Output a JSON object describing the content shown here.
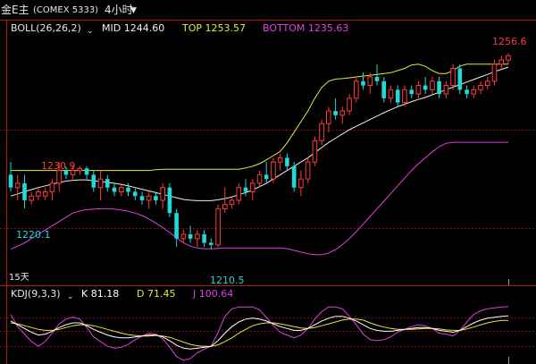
{
  "header": {
    "symbol": "金E主",
    "exchange": "(COMEX 5333)",
    "period": "4小时",
    "period_caret": "▼"
  },
  "boll": {
    "label": "BOLL(26,26,2)",
    "mid": "MID 1244.60",
    "top": "TOP 1253.57",
    "bottom": "BOTTOM 1235.63"
  },
  "kdj": {
    "label": "KDJ(9,3,3)",
    "k": "K 81.18",
    "d": "D 71.45",
    "j": "J 100.64"
  },
  "annotations": {
    "high_last": "1256.6",
    "high_left": "1230.9",
    "low_left": "1220.1",
    "low_mid": "1210.5",
    "days": "15天"
  },
  "colors": {
    "up": "#ff3b3b",
    "down": "#21d9d9",
    "mid": "#f0f0f0",
    "top": "#e6e640",
    "bottom": "#e040e0",
    "k": "#ffffff",
    "d": "#e6e640",
    "j": "#e040e0",
    "grid": "#7a1212",
    "axis": "#b01818"
  },
  "chart_data": {
    "type": "candlestick",
    "y_range": [
      1206,
      1259
    ],
    "candles": [
      [
        1228,
        1231,
        1224,
        1225
      ],
      [
        1225,
        1228,
        1222,
        1226
      ],
      [
        1226,
        1228,
        1220.1,
        1222
      ],
      [
        1222,
        1224,
        1221,
        1223
      ],
      [
        1223,
        1225,
        1222,
        1224
      ],
      [
        1223,
        1225,
        1222,
        1224
      ],
      [
        1224,
        1227,
        1222,
        1226
      ],
      [
        1226,
        1230.9,
        1224,
        1229
      ],
      [
        1229,
        1230,
        1227,
        1228
      ],
      [
        1228,
        1230,
        1227,
        1229
      ],
      [
        1229,
        1230,
        1228,
        1229.5
      ],
      [
        1229.5,
        1230,
        1227,
        1228
      ],
      [
        1228,
        1229,
        1224,
        1225
      ],
      [
        1225,
        1229,
        1222,
        1227
      ],
      [
        1227,
        1228,
        1224,
        1225
      ],
      [
        1225,
        1226,
        1223,
        1224
      ],
      [
        1224,
        1226,
        1223,
        1225
      ],
      [
        1225,
        1226,
        1223,
        1224
      ],
      [
        1224,
        1225,
        1222,
        1223
      ],
      [
        1223,
        1224,
        1221,
        1222
      ],
      [
        1222,
        1224,
        1220,
        1223
      ],
      [
        1223,
        1224,
        1221,
        1222
      ],
      [
        1222,
        1226,
        1220,
        1225
      ],
      [
        1225,
        1226,
        1218,
        1219
      ],
      [
        1219,
        1220,
        1211,
        1213
      ],
      [
        1213,
        1215,
        1212,
        1214
      ],
      [
        1214,
        1216,
        1212,
        1213
      ],
      [
        1213,
        1215,
        1211,
        1214
      ],
      [
        1214,
        1215,
        1211,
        1212
      ],
      [
        1212,
        1213,
        1210.5,
        1211.5
      ],
      [
        1211.5,
        1221,
        1211,
        1220
      ],
      [
        1220,
        1225,
        1219,
        1221
      ],
      [
        1221,
        1223,
        1220,
        1222
      ],
      [
        1222,
        1226,
        1221,
        1225
      ],
      [
        1225,
        1227,
        1223,
        1224
      ],
      [
        1224,
        1227,
        1222,
        1226
      ],
      [
        1226,
        1229,
        1225,
        1228
      ],
      [
        1228,
        1231,
        1226,
        1227
      ],
      [
        1227,
        1232,
        1226,
        1231
      ],
      [
        1231,
        1233,
        1229,
        1232
      ],
      [
        1232,
        1233,
        1229,
        1230
      ],
      [
        1230,
        1231,
        1224,
        1225
      ],
      [
        1225,
        1229,
        1223,
        1227
      ],
      [
        1227,
        1232,
        1226,
        1231
      ],
      [
        1231,
        1237,
        1230,
        1236
      ],
      [
        1236,
        1241,
        1235,
        1240
      ],
      [
        1240,
        1244,
        1238,
        1243
      ],
      [
        1243,
        1246,
        1241,
        1242
      ],
      [
        1242,
        1244,
        1240,
        1243
      ],
      [
        1243,
        1247,
        1242,
        1246
      ],
      [
        1246,
        1251,
        1245,
        1250
      ],
      [
        1250,
        1252,
        1248,
        1249
      ],
      [
        1249,
        1252,
        1247,
        1251
      ],
      [
        1251,
        1254,
        1249,
        1250
      ],
      [
        1250,
        1251,
        1245,
        1246
      ],
      [
        1246,
        1249,
        1245,
        1248
      ],
      [
        1248,
        1249,
        1244,
        1245
      ],
      [
        1245,
        1249,
        1244,
        1248
      ],
      [
        1248,
        1249,
        1246,
        1247
      ],
      [
        1247,
        1250,
        1246,
        1249
      ],
      [
        1249,
        1251,
        1247,
        1248
      ],
      [
        1248,
        1251,
        1247,
        1250
      ],
      [
        1250,
        1251,
        1246,
        1247
      ],
      [
        1247,
        1250,
        1246,
        1249
      ],
      [
        1249,
        1254,
        1248,
        1253
      ],
      [
        1253,
        1254,
        1247,
        1248
      ],
      [
        1248,
        1249,
        1246,
        1247
      ],
      [
        1247,
        1249,
        1246,
        1248
      ],
      [
        1248,
        1250,
        1247,
        1249
      ],
      [
        1249,
        1251,
        1248,
        1250
      ],
      [
        1250,
        1255,
        1249,
        1254
      ],
      [
        1254,
        1256,
        1253,
        1255
      ],
      [
        1255,
        1256.6,
        1254,
        1256
      ]
    ],
    "boll_top": [
      1229,
      1229,
      1229,
      1229,
      1229,
      1229,
      1229,
      1229,
      1229,
      1229,
      1229,
      1229,
      1229,
      1229,
      1229,
      1229,
      1229,
      1229,
      1229,
      1229,
      1229,
      1229.2,
      1229.3,
      1229.3,
      1229.3,
      1229.3,
      1229.3,
      1229.3,
      1229.3,
      1229.3,
      1229.3,
      1229.3,
      1229.3,
      1229.3,
      1229.6,
      1230,
      1230.6,
      1231.5,
      1232.5,
      1233.5,
      1235.5,
      1238,
      1240.5,
      1243,
      1246,
      1248.5,
      1250,
      1250.5,
      1250.6,
      1250.8,
      1251,
      1251.2,
      1251.4,
      1251.6,
      1251.8,
      1252,
      1252.5,
      1253,
      1253.8,
      1254,
      1253.5,
      1252.5,
      1251.8,
      1251.8,
      1252.5,
      1253.57,
      1254,
      1254,
      1254,
      1254,
      1254,
      1254,
      1254
    ],
    "boll_mid": [
      1223,
      1223.5,
      1224,
      1224.5,
      1225,
      1225.4,
      1225.8,
      1226.2,
      1226.5,
      1226.7,
      1226.8,
      1226.8,
      1226.6,
      1226.4,
      1226.2,
      1226,
      1225.7,
      1225.4,
      1225,
      1224.6,
      1224.2,
      1223.8,
      1223.4,
      1223,
      1222.6,
      1222.2,
      1222,
      1221.9,
      1221.9,
      1221.9,
      1222.1,
      1222.4,
      1222.8,
      1223.3,
      1223.8,
      1224.4,
      1225.2,
      1226,
      1227,
      1228,
      1229,
      1230,
      1231,
      1232,
      1233.2,
      1234.4,
      1235.6,
      1236.6,
      1237.6,
      1238.6,
      1239.4,
      1240.2,
      1241,
      1241.8,
      1242.6,
      1243.3,
      1244,
      1244.6,
      1245.2,
      1245.7,
      1246.2,
      1246.8,
      1247.4,
      1248,
      1248.6,
      1249.2,
      1249.8,
      1250.4,
      1251,
      1251.6,
      1252.2,
      1252.8,
      1253.3
    ],
    "boll_bottom": [
      1210.5,
      1211.2,
      1212,
      1213,
      1214,
      1215,
      1216,
      1217,
      1218,
      1219,
      1219.5,
      1219.8,
      1219.9,
      1220,
      1220,
      1219.9,
      1219.7,
      1219.4,
      1219,
      1218.4,
      1217.6,
      1216.6,
      1215.6,
      1214.4,
      1213.2,
      1212,
      1211.2,
      1210.8,
      1210.6,
      1210.6,
      1210.7,
      1210.8,
      1210.8,
      1210.8,
      1210.8,
      1210.8,
      1210.8,
      1210.8,
      1210.8,
      1210.8,
      1210.6,
      1210.2,
      1209.8,
      1209.4,
      1209.2,
      1209.2,
      1209.6,
      1210.4,
      1211.6,
      1213,
      1214.6,
      1216.4,
      1218.2,
      1220,
      1221.8,
      1223.6,
      1225.4,
      1227.2,
      1229,
      1230.6,
      1232,
      1233.4,
      1234.6,
      1235.4,
      1235.63,
      1235.63,
      1235.63,
      1235.63,
      1235.63,
      1235.63,
      1235.63,
      1235.63,
      1235.63
    ],
    "kdj_k": [
      70,
      62,
      54,
      46,
      40,
      42,
      48,
      56,
      62,
      66,
      66,
      60,
      52,
      46,
      40,
      36,
      34,
      34,
      36,
      38,
      40,
      40,
      36,
      28,
      18,
      12,
      10,
      12,
      14,
      16,
      28,
      44,
      58,
      68,
      74,
      76,
      74,
      70,
      64,
      58,
      54,
      50,
      50,
      54,
      62,
      70,
      76,
      80,
      80,
      76,
      70,
      62,
      54,
      50,
      48,
      48,
      50,
      52,
      54,
      56,
      56,
      54,
      50,
      48,
      46,
      50,
      58,
      66,
      72,
      76,
      78,
      80,
      81.18
    ],
    "kdj_d": [
      66,
      64,
      60,
      56,
      52,
      50,
      50,
      52,
      56,
      60,
      62,
      62,
      60,
      56,
      52,
      48,
      44,
      41,
      39,
      38,
      38,
      39,
      38,
      35,
      30,
      25,
      20,
      17,
      16,
      16,
      19,
      26,
      34,
      44,
      52,
      60,
      64,
      66,
      66,
      64,
      61,
      58,
      55,
      54,
      56,
      60,
      64,
      68,
      72,
      74,
      74,
      72,
      66,
      61,
      57,
      54,
      52,
      52,
      52,
      53,
      54,
      54,
      53,
      51,
      50,
      50,
      53,
      57,
      62,
      66,
      69,
      71,
      71.45
    ],
    "kdj_j": [
      84,
      58,
      42,
      26,
      16,
      26,
      44,
      64,
      74,
      78,
      74,
      56,
      36,
      26,
      16,
      12,
      14,
      20,
      30,
      38,
      44,
      42,
      32,
      14,
      -6,
      -14,
      -10,
      2,
      10,
      16,
      46,
      80,
      96,
      100,
      100,
      100,
      94,
      78,
      60,
      46,
      40,
      34,
      40,
      54,
      74,
      90,
      100,
      100,
      96,
      80,
      62,
      42,
      30,
      28,
      30,
      36,
      46,
      52,
      58,
      62,
      60,
      54,
      44,
      42,
      38,
      50,
      68,
      84,
      92,
      96,
      98,
      100,
      100.64
    ],
    "kdj_range": [
      -20,
      110
    ]
  }
}
